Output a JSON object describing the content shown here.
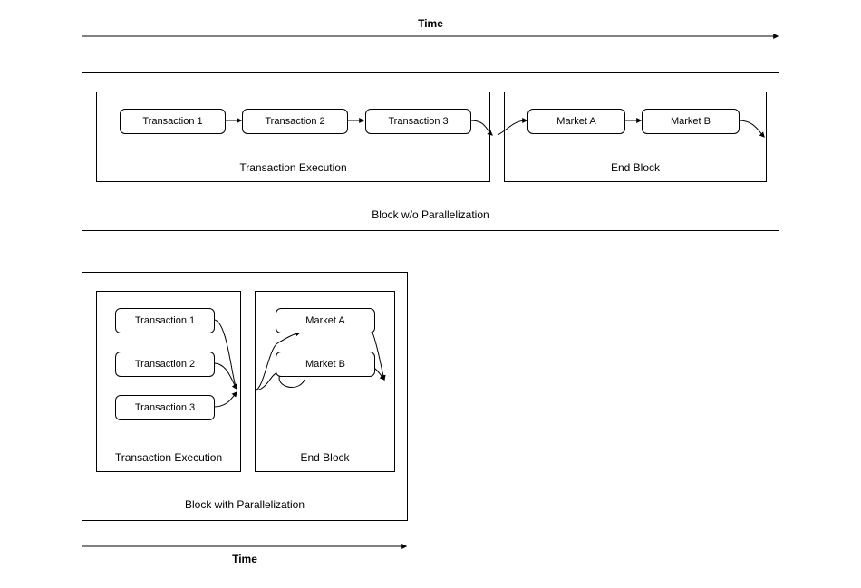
{
  "timeLabelTop": "Time",
  "timeLabelBottom": "Time",
  "block1": {
    "title": "Block w/o Parallelization",
    "stageTx": "Transaction Execution",
    "stageEnd": "End Block",
    "tx1": "Transaction 1",
    "tx2": "Transaction 2",
    "tx3": "Transaction 3",
    "mA": "Market A",
    "mB": "Market B"
  },
  "block2": {
    "title": "Block with Parallelization",
    "stageTx": "Transaction Execution",
    "stageEnd": "End Block",
    "tx1": "Transaction 1",
    "tx2": "Transaction 2",
    "tx3": "Transaction 3",
    "mA": "Market A",
    "mB": "Market B"
  }
}
